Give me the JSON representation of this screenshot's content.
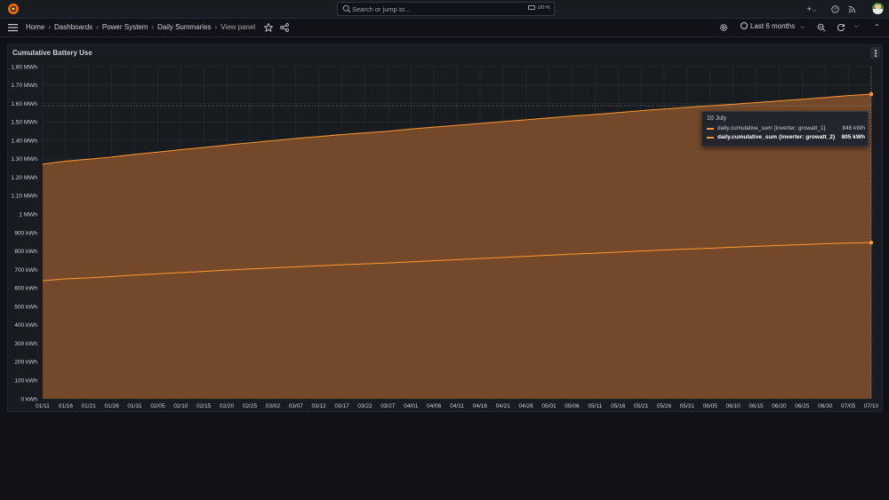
{
  "topbar": {
    "search_placeholder": "Search or jump to...",
    "search_shortcut": "ctrl+k",
    "new_label": "+"
  },
  "breadcrumb": [
    "Home",
    "Dashboards",
    "Power System",
    "Daily Summaries",
    "View panel"
  ],
  "time_range": "Last 6 months",
  "panel": {
    "title": "Cumulative Battery Use"
  },
  "tooltip": {
    "title": "10 July",
    "rows": [
      {
        "name": "daily.cumulative_sum {inverter: growatt_1}",
        "value": "846 kWh",
        "bold": false
      },
      {
        "name": "daily.cumulative_sum {inverter: growatt_2}",
        "value": "805 kWh",
        "bold": true
      }
    ]
  },
  "colors": {
    "series": "#ff9830",
    "fill": "#73492a",
    "background": "#181b1f"
  },
  "chart_data": {
    "type": "area",
    "stacked": true,
    "title": "Cumulative Battery Use",
    "unit": "kWh",
    "ylim": [
      0,
      1800
    ],
    "yticks": [
      "0 kWh",
      "100 kWh",
      "200 kWh",
      "300 kWh",
      "400 kWh",
      "500 kWh",
      "600 kWh",
      "700 kWh",
      "800 kWh",
      "900 kWh",
      "1 MWh",
      "1.10 MWh",
      "1.20 MWh",
      "1.30 MWh",
      "1.40 MWh",
      "1.50 MWh",
      "1.60 MWh",
      "1.70 MWh",
      "1.80 MWh"
    ],
    "x": [
      "01/11",
      "01/16",
      "01/21",
      "01/26",
      "01/31",
      "02/05",
      "02/10",
      "02/15",
      "02/20",
      "02/25",
      "03/02",
      "03/07",
      "03/12",
      "03/17",
      "03/22",
      "03/27",
      "04/01",
      "04/06",
      "04/11",
      "04/16",
      "04/21",
      "04/26",
      "05/01",
      "05/06",
      "05/11",
      "05/16",
      "05/21",
      "05/26",
      "05/31",
      "06/05",
      "06/10",
      "06/15",
      "06/20",
      "06/25",
      "06/30",
      "07/05",
      "07/10"
    ],
    "series": [
      {
        "name": "daily.cumulative_sum {inverter: growatt_1}",
        "values": [
          640,
          650,
          655,
          662,
          670,
          677,
          684,
          690,
          697,
          703,
          709,
          715,
          721,
          726,
          731,
          736,
          742,
          748,
          754,
          760,
          766,
          772,
          778,
          784,
          789,
          795,
          801,
          806,
          811,
          816,
          821,
          826,
          831,
          835,
          840,
          844,
          846
        ]
      },
      {
        "name": "daily.cumulative_sum {inverter: growatt_2}",
        "values": [
          632,
          638,
          643,
          648,
          655,
          660,
          666,
          672,
          678,
          684,
          690,
          696,
          700,
          706,
          710,
          714,
          720,
          724,
          728,
          732,
          736,
          740,
          744,
          748,
          752,
          756,
          760,
          764,
          768,
          772,
          775,
          779,
          783,
          788,
          793,
          799,
          805
        ]
      }
    ],
    "stacked_totals": [
      1272,
      1288,
      1298,
      1310,
      1325,
      1337,
      1350,
      1362,
      1375,
      1387,
      1399,
      1411,
      1421,
      1432,
      1441,
      1450,
      1462,
      1472,
      1482,
      1492,
      1502,
      1512,
      1522,
      1532,
      1541,
      1551,
      1561,
      1570,
      1579,
      1588,
      1596,
      1605,
      1614,
      1623,
      1633,
      1643,
      1651
    ],
    "hover_x": "07/10",
    "grid": true
  }
}
